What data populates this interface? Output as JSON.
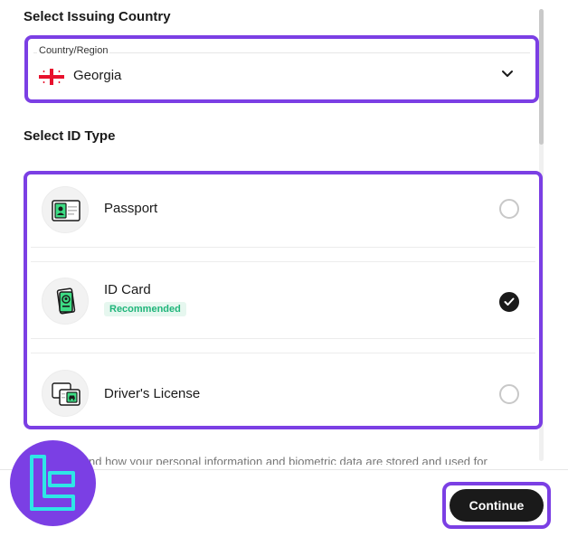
{
  "issuing": {
    "title": "Select Issuing Country",
    "field_label": "Country/Region",
    "selected_country": "Georgia",
    "flag_icon": "georgia-flag-icon"
  },
  "id_type": {
    "title": "Select ID Type",
    "options": [
      {
        "label": "Passport",
        "icon": "passport-icon",
        "selected": false
      },
      {
        "label": "ID Card",
        "icon": "id-card-icon",
        "badge": "Recommended",
        "selected": true
      },
      {
        "label": "Driver's License",
        "icon": "drivers-license-icon",
        "selected": false
      }
    ]
  },
  "footer": {
    "disclaimer": "nd how your personal information and biometric data are stored and used for",
    "continue_label": "Continue"
  },
  "colors": {
    "highlight": "#7b3fe4",
    "badge_text": "#1fb57a",
    "primary_button": "#1a1a1a"
  }
}
